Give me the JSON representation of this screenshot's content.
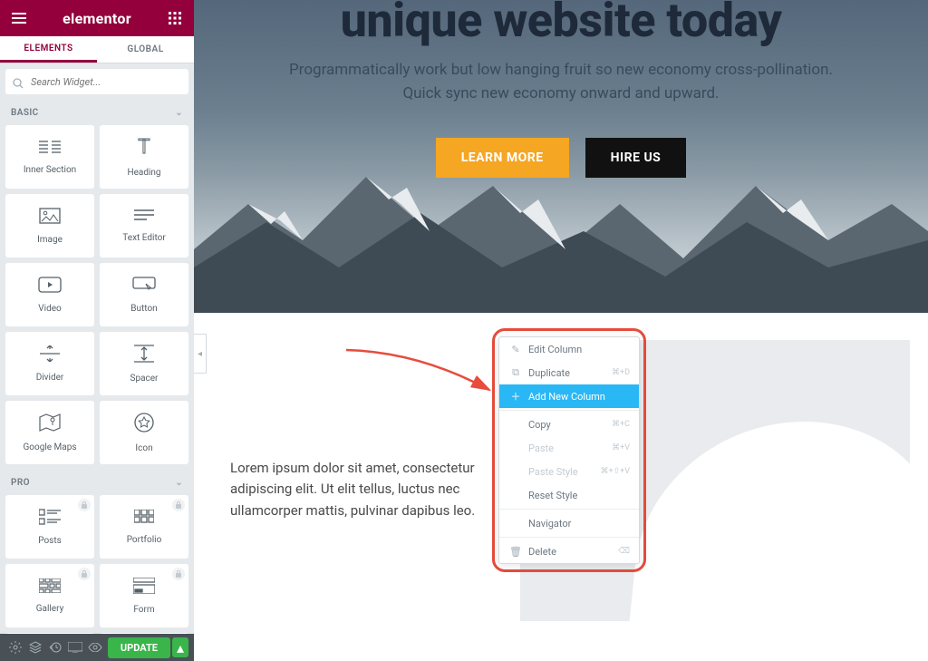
{
  "brand": "elementor",
  "tabs": {
    "elements": "ELEMENTS",
    "global": "GLOBAL"
  },
  "search": {
    "placeholder": "Search Widget..."
  },
  "cat_basic": "BASIC",
  "cat_pro": "PRO",
  "widgets_basic": [
    {
      "label": "Inner Section"
    },
    {
      "label": "Heading"
    },
    {
      "label": "Image"
    },
    {
      "label": "Text Editor"
    },
    {
      "label": "Video"
    },
    {
      "label": "Button"
    },
    {
      "label": "Divider"
    },
    {
      "label": "Spacer"
    },
    {
      "label": "Google Maps"
    },
    {
      "label": "Icon"
    }
  ],
  "widgets_pro": [
    {
      "label": "Posts"
    },
    {
      "label": "Portfolio"
    },
    {
      "label": "Gallery"
    },
    {
      "label": "Form"
    }
  ],
  "footer": {
    "update": "UPDATE"
  },
  "hero": {
    "title": "unique website today",
    "subtitle": "Programmatically work but low hanging fruit so new economy cross-pollination. Quick sync new economy onward and upward.",
    "btn1": "LEARN MORE",
    "btn2": "HIRE US"
  },
  "lorem": "Lorem ipsum dolor sit amet, consectetur adipiscing elit. Ut elit tellus, luctus nec ullamcorper mattis, pulvinar dapibus leo.",
  "ctx": {
    "edit": "Edit Column",
    "dup": "Duplicate",
    "dup_k": "⌘+D",
    "add": "Add New Column",
    "copy": "Copy",
    "copy_k": "⌘+C",
    "paste": "Paste",
    "paste_k": "⌘+V",
    "pstyle": "Paste Style",
    "pstyle_k": "⌘+⇧+V",
    "rstyle": "Reset Style",
    "nav": "Navigator",
    "del": "Delete"
  }
}
